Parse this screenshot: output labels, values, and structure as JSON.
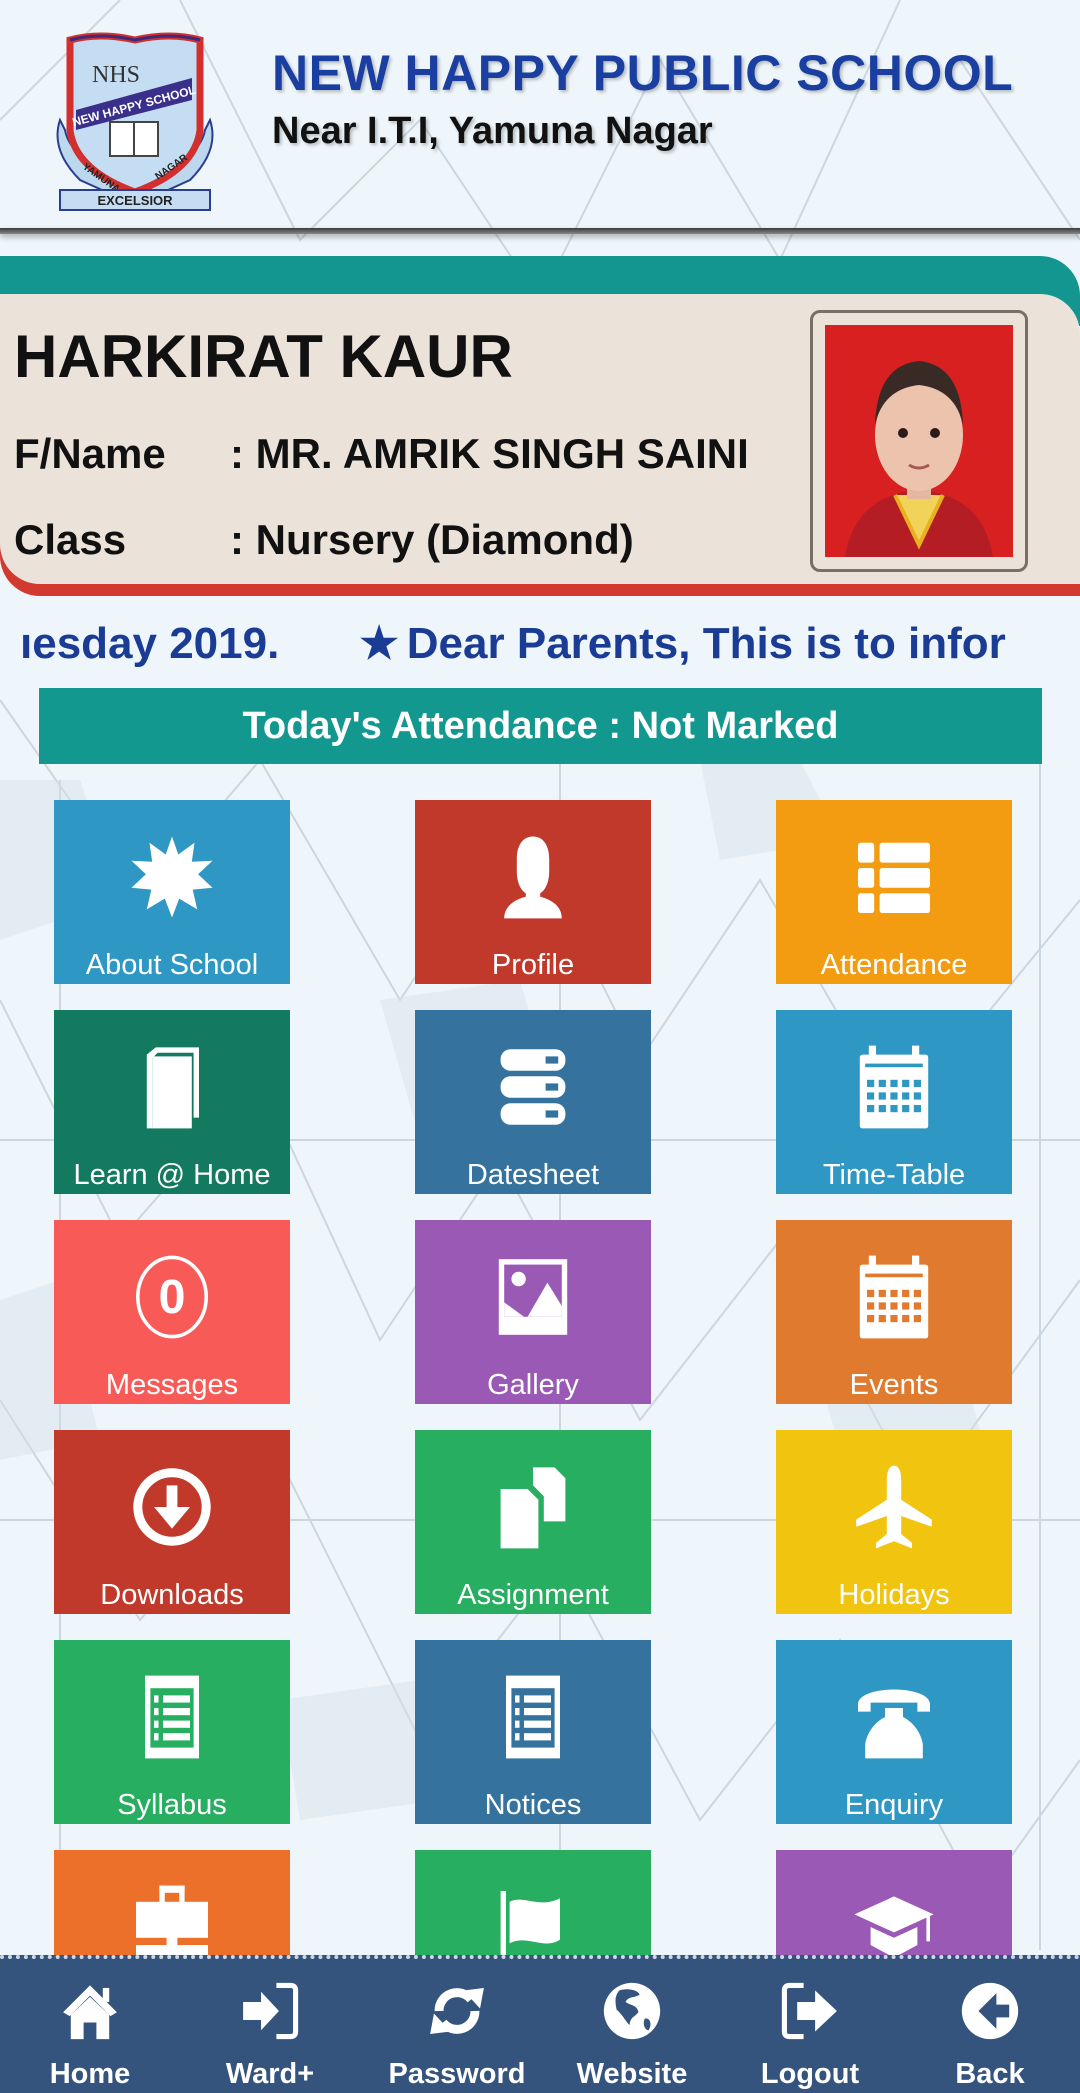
{
  "header": {
    "school_name": "NEW HAPPY PUBLIC SCHOOL",
    "school_address": "Near I.T.I, Yamuna Nagar",
    "logo": {
      "monogram": "NHS",
      "banner_text": "NEW HAPPY SCHOOL",
      "ribbon_left": "YAMUNA",
      "ribbon_right": "NAGAR",
      "motto": "EXCELSIOR"
    }
  },
  "student": {
    "name": "HARKIRAT KAUR",
    "father_label": "F/Name",
    "father_value": ": MR. AMRIK SINGH SAINI",
    "class_label": "Class",
    "class_value": ": Nursery (Diamond)",
    "photo_alt": "student-photo"
  },
  "ticker": {
    "text_before": "ıesday 2019.",
    "star": "★",
    "text_after": "Dear Parents,  This is to infor"
  },
  "attendance": {
    "text": "Today's Attendance : Not Marked"
  },
  "tiles": [
    {
      "label": "About School",
      "icon": "badge-icon",
      "color": "#2e97c4"
    },
    {
      "label": "Profile",
      "icon": "user-icon",
      "color": "#c0392b"
    },
    {
      "label": "Attendance",
      "icon": "list-icon",
      "color": "#f39c12"
    },
    {
      "label": "Learn @ Home",
      "icon": "book-icon",
      "color": "#137a5f"
    },
    {
      "label": "Datesheet",
      "icon": "server-icon",
      "color": "#35739e"
    },
    {
      "label": "Time-Table",
      "icon": "calendar-icon",
      "color": "#2e97c4"
    },
    {
      "label": "Messages",
      "icon": "message-count-icon",
      "color": "#f85a57",
      "badge": "0"
    },
    {
      "label": "Gallery",
      "icon": "image-icon",
      "color": "#9b59b6"
    },
    {
      "label": "Events",
      "icon": "calendar-icon",
      "color": "#e07a2e"
    },
    {
      "label": "Downloads",
      "icon": "download-circle-icon",
      "color": "#c0392b"
    },
    {
      "label": "Assignment",
      "icon": "copy-files-icon",
      "color": "#27ae60"
    },
    {
      "label": "Holidays",
      "icon": "airplane-icon",
      "color": "#f1c40f"
    },
    {
      "label": "Syllabus",
      "icon": "list-document-icon",
      "color": "#27ae60"
    },
    {
      "label": "Notices",
      "icon": "list-document-icon",
      "color": "#35739e"
    },
    {
      "label": "Enquiry",
      "icon": "phone-icon",
      "color": "#2e97c4"
    },
    {
      "label": "",
      "icon": "briefcase-icon",
      "color": "#ec6f2a"
    },
    {
      "label": "",
      "icon": "flag-icon",
      "color": "#27ae60"
    },
    {
      "label": "",
      "icon": "graduation-cap-icon",
      "color": "#9b59b6"
    }
  ],
  "bottom_nav": [
    {
      "label": "Home",
      "icon": "home-icon"
    },
    {
      "label": "Ward+",
      "icon": "sign-in-icon"
    },
    {
      "label": "Password",
      "icon": "refresh-icon"
    },
    {
      "label": "Website",
      "icon": "globe-icon"
    },
    {
      "label": "Logout",
      "icon": "sign-out-icon"
    },
    {
      "label": "Back",
      "icon": "back-arrow-circle-icon"
    }
  ]
}
